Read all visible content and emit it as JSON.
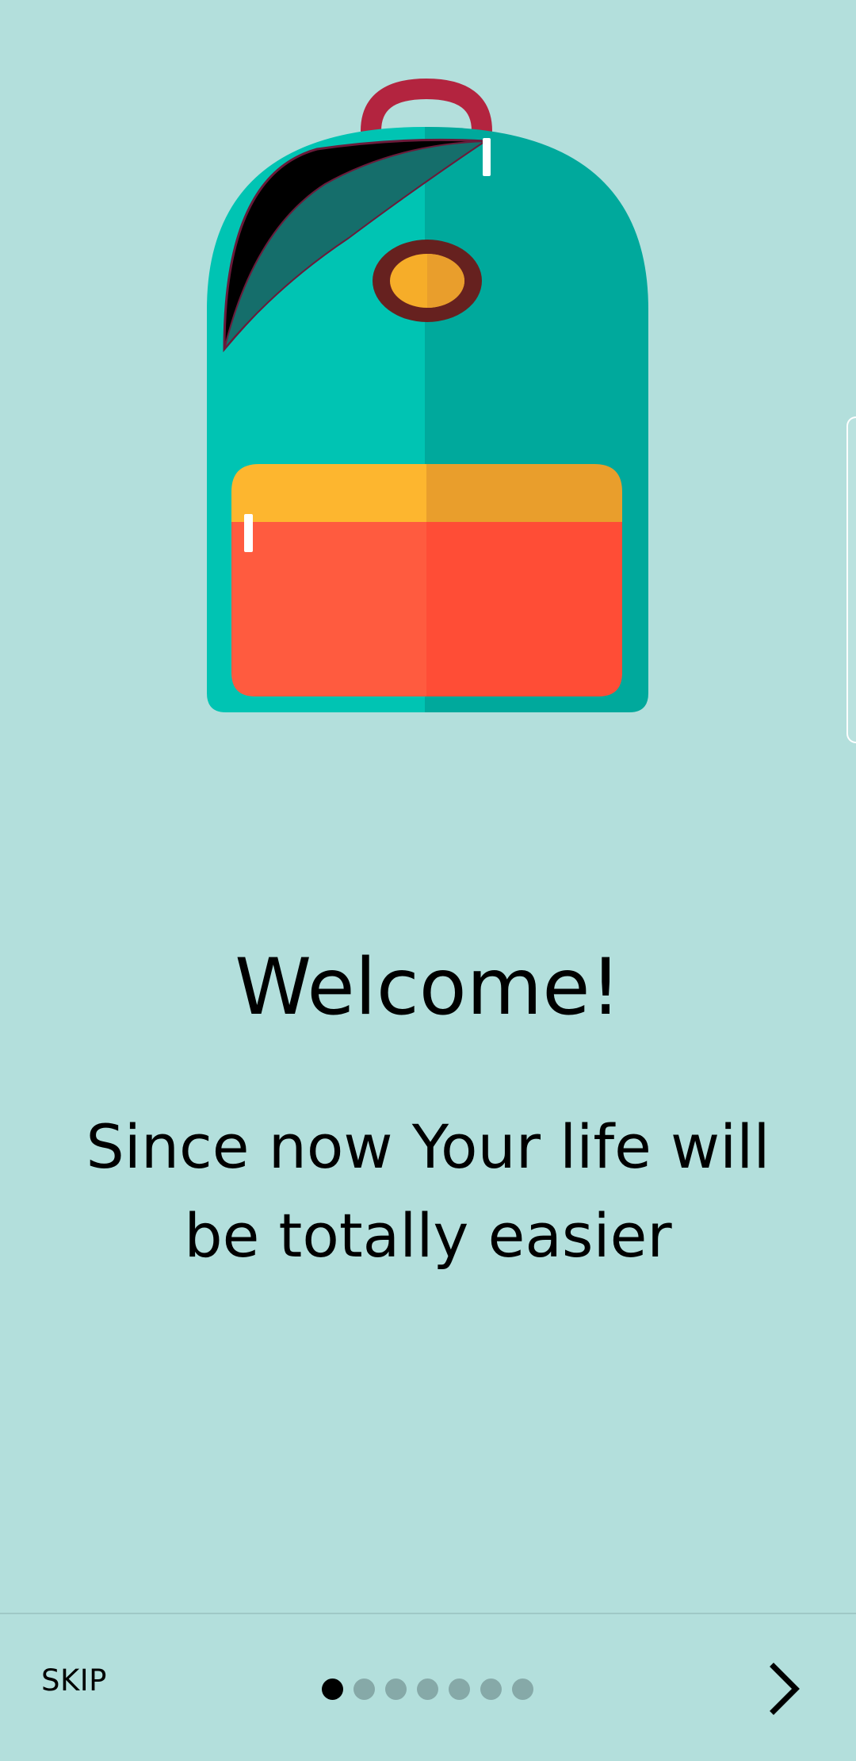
{
  "colors": {
    "background": "#b3dfdc",
    "backpack_left": "#00c4b3",
    "backpack_right": "#00a99c",
    "pocket_top_left": "#fdb62f",
    "pocket_top_right": "#e99e2c",
    "pocket_bottom_left": "#ff5b3f",
    "pocket_bottom_right": "#ff4d36",
    "handle": "#b3243f",
    "clasp_ring": "#66211f",
    "clasp_center": "#f6ad29",
    "active_dot": "#000000",
    "inactive_dot": "#86a9a8"
  },
  "hero": {
    "illustration": "backpack-illustration"
  },
  "onboarding": {
    "title": "Welcome!",
    "subtitle": "Since now Your life will be totally easier"
  },
  "footer": {
    "skip_label": "SKIP",
    "page_indicator": {
      "total": 7,
      "current": 1
    },
    "next_icon": "chevron-right-icon"
  }
}
